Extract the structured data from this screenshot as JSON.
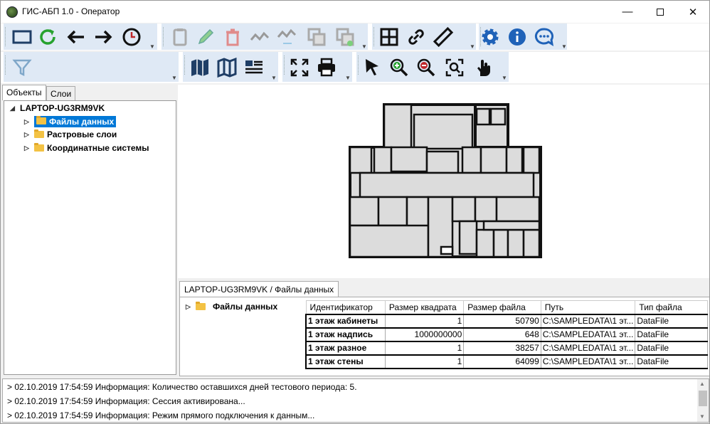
{
  "window": {
    "title": "ГИС-АБП 1.0 - Оператор"
  },
  "left_tabs": [
    "Объекты",
    "Слои"
  ],
  "tree": {
    "root": "LAPTOP-UG3RM9VK",
    "children": [
      "Файлы данных",
      "Растровые слои",
      "Координатные системы"
    ]
  },
  "bottom": {
    "tab": "LAPTOP-UG3RM9VK / Файлы данных",
    "tree_item": "Файлы данных",
    "columns": [
      "Идентификатор",
      "Размер квадрата",
      "Размер файла",
      "Путь",
      "Тип файла"
    ],
    "rows": [
      [
        "1 этаж кабинеты",
        "1",
        "50790",
        "C:\\SAMPLEDATA\\1 эт...",
        "DataFile"
      ],
      [
        "1 этаж надпись",
        "1000000000",
        "648",
        "C:\\SAMPLEDATA\\1 эт...",
        "DataFile"
      ],
      [
        "1 этаж разное",
        "1",
        "38257",
        "C:\\SAMPLEDATA\\1 эт...",
        "DataFile"
      ],
      [
        "1 этаж стены",
        "1",
        "64099",
        "C:\\SAMPLEDATA\\1 эт...",
        "DataFile"
      ]
    ]
  },
  "log": [
    "> 02.10.2019 17:54:59 Информация: Количество оставшихся дней тестового периода: 5.",
    "> 02.10.2019 17:54:59 Информация: Сессия активирована...",
    "> 02.10.2019 17:54:59 Информация: Режим прямого подключения к данным..."
  ],
  "colors": {
    "accent": "#0078d7",
    "toolbar": "#dfe9f5",
    "icon_blue": "#1f62b8"
  }
}
